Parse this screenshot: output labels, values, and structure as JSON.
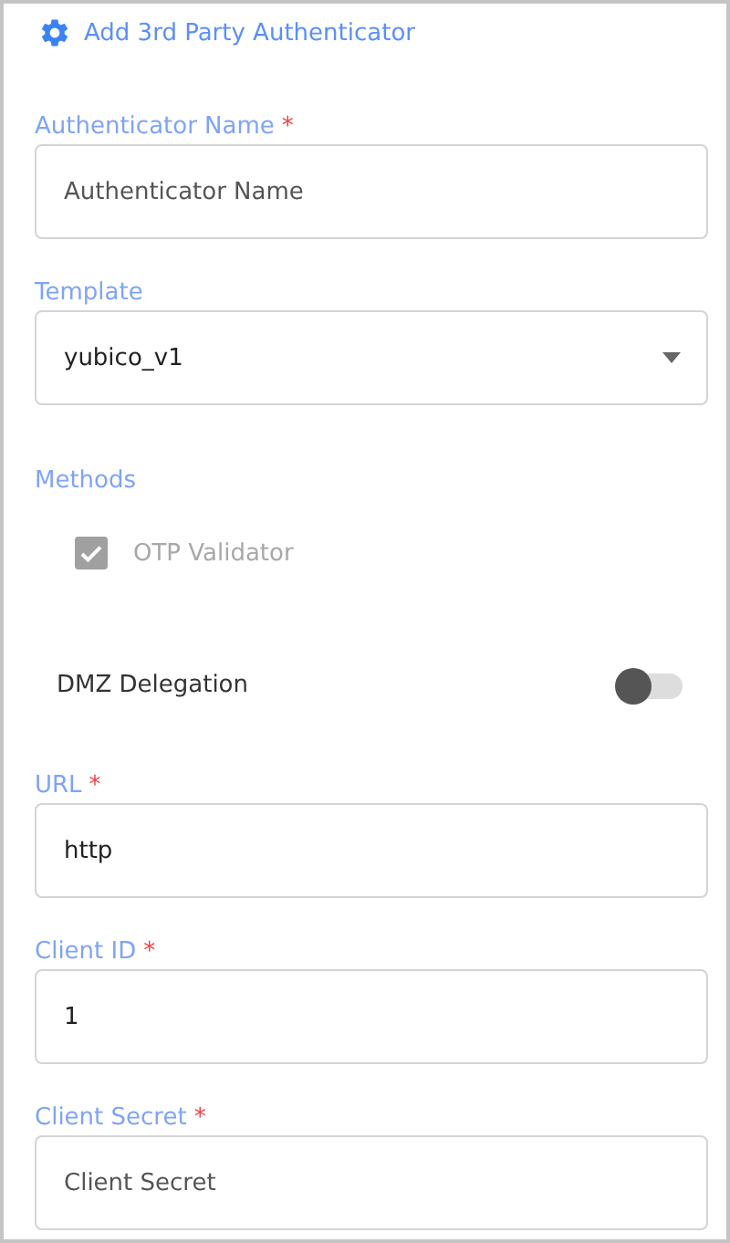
{
  "header": {
    "title": "Add 3rd Party Authenticator"
  },
  "items": [
    {
      "kind": "text",
      "label": "Authenticator Name",
      "required_mark": "*",
      "placeholder": "Authenticator Name"
    },
    {
      "kind": "select",
      "label": "Template",
      "value": "yubico_v1"
    },
    {
      "kind": "heading",
      "label": "Methods"
    },
    {
      "kind": "checkbox",
      "label": "OTP Validator",
      "checked": true,
      "disabled": true
    },
    {
      "kind": "toggle",
      "label": "DMZ Delegation",
      "on": false
    },
    {
      "kind": "text",
      "label": "URL",
      "required_mark": "*",
      "value": "http"
    },
    {
      "kind": "text",
      "label": "Client ID",
      "required_mark": "*",
      "value": "1"
    },
    {
      "kind": "text",
      "label": "Client Secret",
      "required_mark": "*",
      "placeholder": "Client Secret"
    }
  ]
}
